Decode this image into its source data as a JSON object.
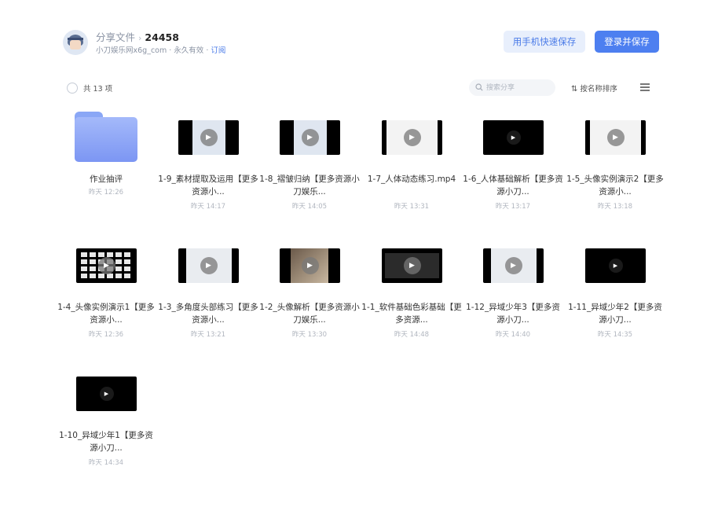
{
  "header": {
    "breadcrumb_root": "分享文件",
    "breadcrumb_sep": "›",
    "breadcrumb_current": "24458",
    "owner_line": "小刀娱乐网x6g_com · 永久有效 · ",
    "subscribe_link": "订阅",
    "phone_save_button": "用手机快速保存",
    "login_save_button": "登录并保存"
  },
  "toolbar": {
    "count_label": "共 13 项",
    "search_placeholder": "搜索分享",
    "sort_label": "按名称排序",
    "sort_icon": "⇅"
  },
  "icons": {
    "play": "▶",
    "search": "search-icon",
    "menu": "list-menu-icon"
  },
  "colors": {
    "accent": "#4d7ff0",
    "folder": "#8aa7f6",
    "video_bg": "#000000"
  },
  "files": [
    {
      "name": "作业抽评",
      "time": "昨天 12:26",
      "kind": "folder"
    },
    {
      "name": "1-9_素材提取及运用【更多资源小...",
      "time": "昨天 14:17",
      "kind": "video",
      "thumb": "ui"
    },
    {
      "name": "1-8_褶皱归纳【更多资源小刀娱乐...",
      "time": "昨天 14:05",
      "kind": "video",
      "thumb": "ui"
    },
    {
      "name": "1-7_人体动态练习.mp4",
      "time": "昨天 13:31",
      "kind": "video",
      "thumb": "sketch"
    },
    {
      "name": "1-6_人体基础解析【更多资源小刀...",
      "time": "昨天 13:17",
      "kind": "video",
      "thumb": "black"
    },
    {
      "name": "1-5_头像实例演示2【更多资源小...",
      "time": "昨天 13:18",
      "kind": "video",
      "thumb": "sketch"
    },
    {
      "name": "1-4_头像实例演示1【更多资源小...",
      "time": "昨天 12:36",
      "kind": "video",
      "thumb": "cells"
    },
    {
      "name": "1-3_多角度头部练习【更多资源小...",
      "time": "昨天 13:21",
      "kind": "video",
      "thumb": "light"
    },
    {
      "name": "1-2_头像解析【更多资源小刀娱乐...",
      "time": "昨天 13:30",
      "kind": "video",
      "thumb": "photo"
    },
    {
      "name": "1-1_软件基础色彩基础【更多资源...",
      "time": "昨天 14:48",
      "kind": "video",
      "thumb": "dark"
    },
    {
      "name": "1-12_异域少年3【更多资源小刀...",
      "time": "昨天 14:40",
      "kind": "video",
      "thumb": "light"
    },
    {
      "name": "1-11_异域少年2【更多资源小刀...",
      "time": "昨天 14:35",
      "kind": "video",
      "thumb": "black"
    },
    {
      "name": "1-10_异域少年1【更多资源小刀...",
      "time": "昨天 14:34",
      "kind": "video",
      "thumb": "black"
    }
  ]
}
